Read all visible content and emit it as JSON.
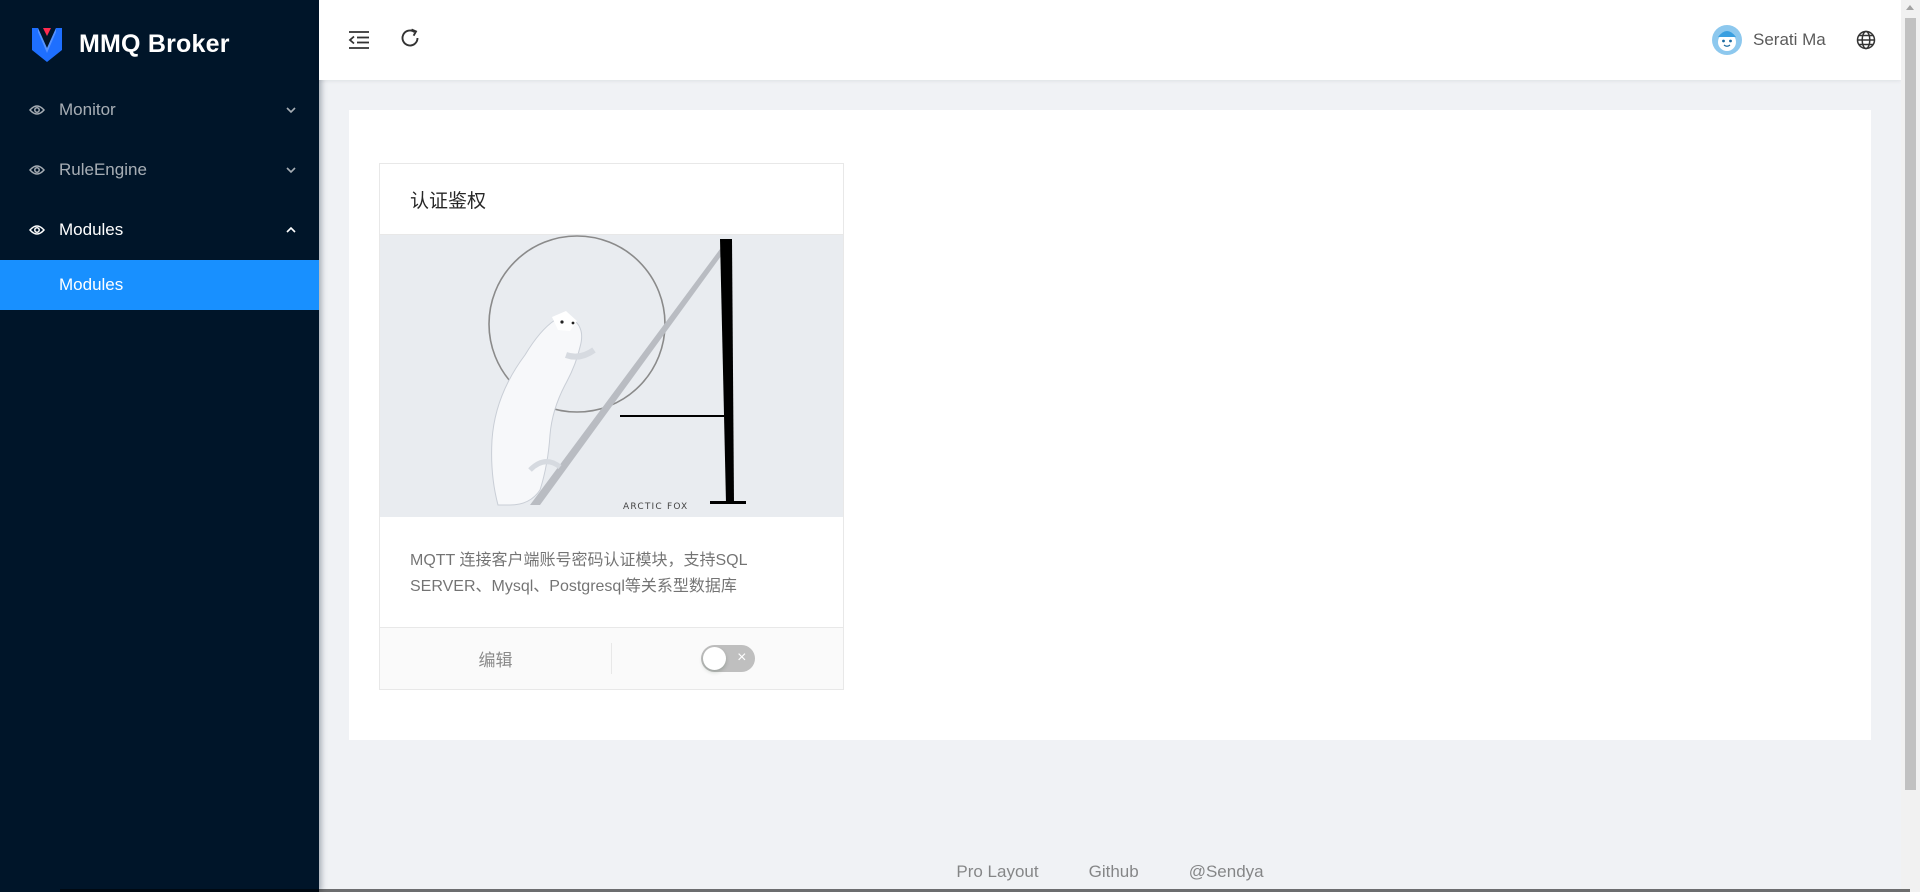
{
  "app": {
    "title": "MMQ Broker"
  },
  "sidebar": {
    "items": [
      {
        "label": "Monitor",
        "icon": "eye-icon",
        "expanded": false
      },
      {
        "label": "RuleEngine",
        "icon": "eye-icon",
        "expanded": false
      },
      {
        "label": "Modules",
        "icon": "eye-icon",
        "expanded": true,
        "children": [
          {
            "label": "Modules",
            "selected": true
          }
        ]
      }
    ]
  },
  "header": {
    "user_name": "Serati Ma",
    "icons": [
      "menu-fold-icon",
      "reload-icon",
      "globe-icon"
    ]
  },
  "module_card": {
    "title": "认证鉴权",
    "cover_text": "ARCTIC FOX",
    "description": "MQTT 连接客户端账号密码认证模块，支持SQL SERVER、Mysql、Postgresql等关系型数据库",
    "edit_label": "编辑",
    "switch_on": false,
    "switch_off_symbol": "×"
  },
  "footer": {
    "links": [
      "Pro Layout",
      "Github",
      "@Sendya"
    ]
  },
  "colors": {
    "sidebar_bg": "#001529",
    "primary": "#1890ff",
    "page_bg": "#f0f2f5"
  }
}
